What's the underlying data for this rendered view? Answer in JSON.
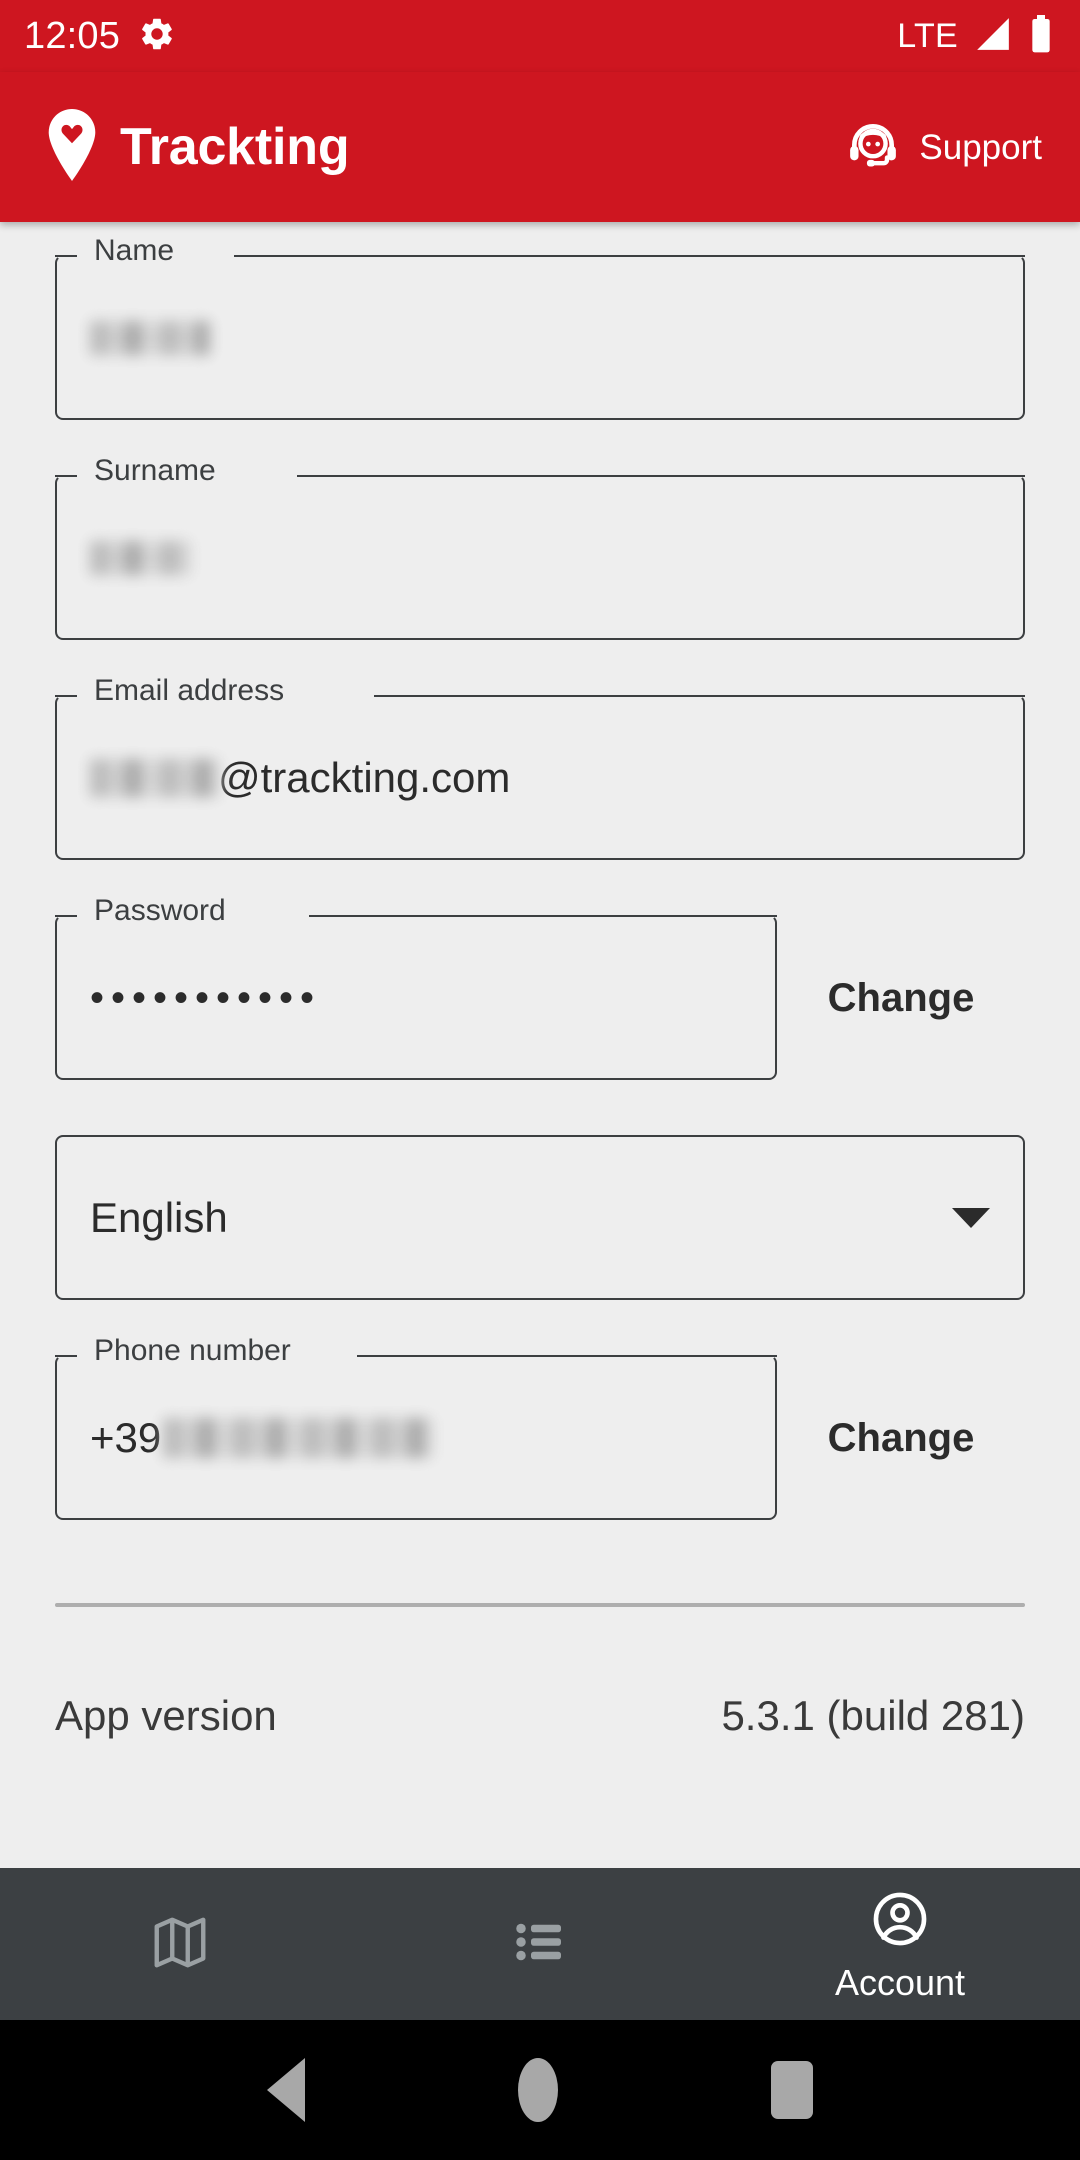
{
  "theme": {
    "brand_red": "#CE1620",
    "page_background": "#EEEEEE",
    "bottom_nav_background": "#3C4043",
    "text_primary": "#2B2B2B",
    "border": "#3C3F41"
  },
  "status_bar": {
    "clock": "12:05",
    "settings_icon": "gear-icon",
    "network_label": "LTE",
    "signal_icon": "signal-bars-icon",
    "battery_icon": "battery-icon"
  },
  "app_bar": {
    "logo_icon": "map-pin-heart-icon",
    "title": "Trackting",
    "support": {
      "icon": "headset-support-icon",
      "label": "Support"
    }
  },
  "form": {
    "fields": [
      {
        "name": "name",
        "label": "Name",
        "value": "",
        "redacted": true,
        "redacted_width": 120,
        "has_change_button": false
      },
      {
        "name": "surname",
        "label": "Surname",
        "value": "",
        "redacted": true,
        "redacted_width": 100,
        "has_change_button": false
      },
      {
        "name": "email",
        "label": "Email address",
        "value": "@trackting.com",
        "redacted": true,
        "redacted_width": 130,
        "has_change_button": false
      },
      {
        "name": "password",
        "label": "Password",
        "value": "•••••••••••",
        "redacted": false,
        "has_change_button": true,
        "change_label": "Change"
      }
    ],
    "language_select": {
      "name": "language",
      "selected": "English",
      "arrow_icon": "chevron-down-icon"
    },
    "phone_field": {
      "name": "phone",
      "label": "Phone number",
      "prefix": "+39",
      "value": "",
      "redacted": true,
      "redacted_width": 270,
      "has_change_button": true,
      "change_label": "Change"
    }
  },
  "app_version": {
    "label": "App version",
    "value": "5.3.1 (build 281)"
  },
  "bottom_nav": {
    "items": [
      {
        "name": "map",
        "icon": "map-icon",
        "label": "",
        "active": false
      },
      {
        "name": "list",
        "icon": "list-icon",
        "label": "",
        "active": false
      },
      {
        "name": "account",
        "icon": "account-circle-icon",
        "label": "Account",
        "active": true
      }
    ]
  },
  "system_nav": {
    "back": "back-triangle-icon",
    "home": "home-circle-icon",
    "recents": "recents-square-icon"
  }
}
